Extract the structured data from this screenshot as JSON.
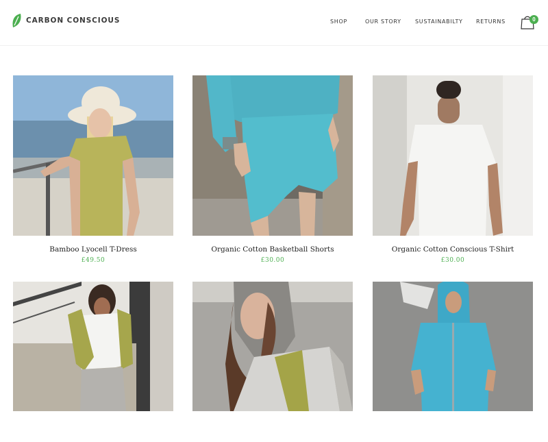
{
  "brand": {
    "name": "Carbon Conscious",
    "logo_icon": "leaf-icon",
    "accent_color": "#4caf50"
  },
  "nav": {
    "items": [
      {
        "label": "SHOP"
      },
      {
        "label": "OUR STORY"
      },
      {
        "label": "SUSTAINABILTY"
      },
      {
        "label": "RETURNS"
      }
    ],
    "cart": {
      "icon": "shopping-bag-icon",
      "count": "0"
    }
  },
  "products": [
    {
      "title": "Bamboo Lyocell T-Dress",
      "price": "£49.50",
      "image": "woman-in-hat-olive-tshirt-dress-photo"
    },
    {
      "title": "Organic Cotton Basketball Shorts",
      "price": "£30.00",
      "image": "aqua-sweatshirt-and-shorts-photo"
    },
    {
      "title": "Organic Cotton Conscious T-Shirt",
      "price": "£30.00",
      "image": "man-in-white-tshirt-photo"
    },
    {
      "title": "",
      "price": "",
      "image": "person-grey-olive-hoodie-outdoor-photo"
    },
    {
      "title": "",
      "price": "",
      "image": "woman-grey-olive-hoodie-photo"
    },
    {
      "title": "",
      "price": "",
      "image": "man-aqua-zip-hoodie-photo"
    }
  ]
}
